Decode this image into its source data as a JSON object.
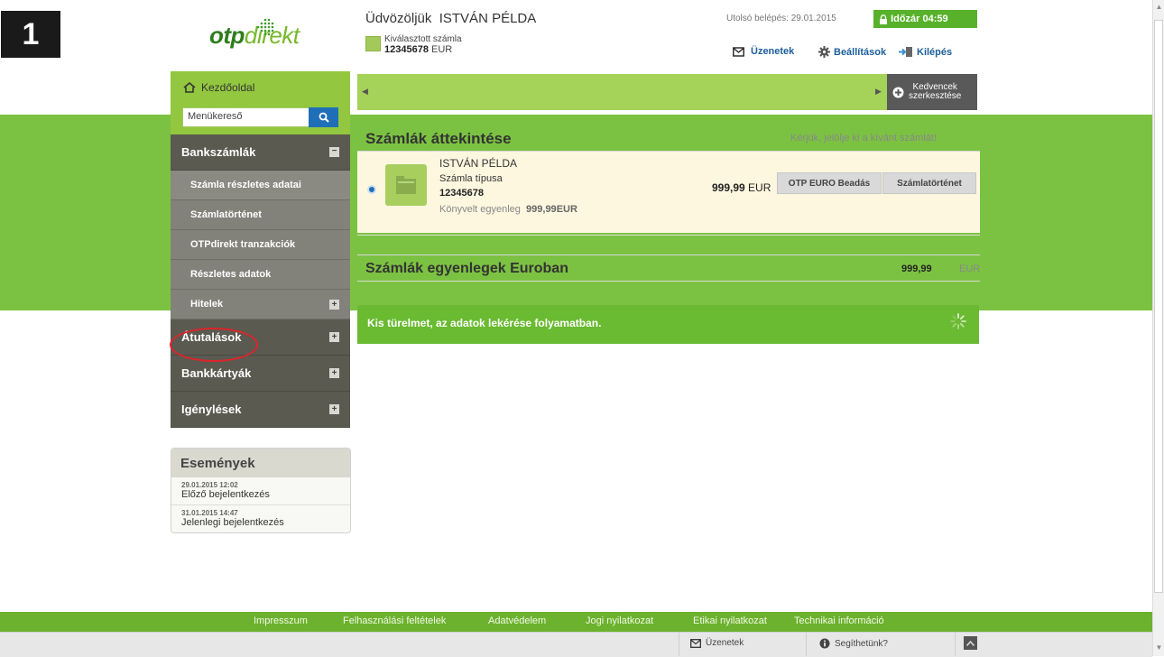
{
  "step_badge": "1",
  "logo": {
    "part1": "otp",
    "part2": "direkt"
  },
  "header": {
    "welcome_prefix": "Üdvözöljük",
    "user_name": "ISTVÁN PÉLDA",
    "selected_account_label": "Kiválasztott számla",
    "selected_account_number": "12345678",
    "selected_account_currency": "EUR",
    "last_login_label": "Utolsó belépés:",
    "last_login_date": "29.01.2015",
    "timer_label": "Időzár",
    "timer_value": "04:59",
    "messages_label": "Üzenetek",
    "settings_label": "Beállítások",
    "logout_label": "Kilépés"
  },
  "nav": {
    "home_label": "Kezdőoldal",
    "search_placeholder": "Menükereső",
    "sections": [
      {
        "label": "Bankszámlák",
        "expanded": true
      },
      {
        "label": "Átutalások",
        "expanded": false
      },
      {
        "label": "Bankkártyák",
        "expanded": false
      },
      {
        "label": "Igénylések",
        "expanded": false
      }
    ],
    "sub_items": [
      {
        "label": "Számla részletes adatai"
      },
      {
        "label": "Számlatörténet"
      },
      {
        "label": "OTPdirekt tranzakciók"
      },
      {
        "label": "Részletes adatok"
      },
      {
        "label": "Hitelek"
      }
    ]
  },
  "events": {
    "title": "Események",
    "items": [
      {
        "date": "29.01.2015 12:02",
        "text": "Előző bejelentkezés"
      },
      {
        "date": "31.01.2015 14:47",
        "text": "Jelenlegi bejelentkezés"
      }
    ]
  },
  "favorites": {
    "edit_label_line1": "Kedvencek",
    "edit_label_line2": "szerkesztése",
    "left_arrow": "◀",
    "right_arrow": "▶"
  },
  "overview": {
    "title": "Számlák áttekintése",
    "hint": "Kérjük, jelölje ki a kívánt számlát!",
    "account": {
      "holder": "ISTVÁN PÉLDA",
      "type": "Számla típusa",
      "number": "12345678",
      "booked_label": "Könyvelt egyenleg",
      "booked_value": "999,99",
      "booked_currency": "EUR",
      "balance_value": "999,99",
      "balance_currency": "EUR",
      "btn_deposit": "OTP EURO Beadás",
      "btn_history": "Számlatörténet"
    }
  },
  "euro_summary": {
    "title": "Számlák egyenlegek Euroban",
    "value": "999,99",
    "currency": "EUR"
  },
  "loading": {
    "text": "Kis türelmet, az adatok lekérése folyamatban."
  },
  "footer": {
    "links": [
      "Impresszum",
      "Felhasználási feltételek",
      "Adatvédelem",
      "Jogi nyilatkozat",
      "Etikai nyilatkozat",
      "Technikai információ"
    ]
  },
  "bottom_bar": {
    "messages_label": "Üzenetek",
    "help_label": "Segíthetünk?"
  },
  "colors": {
    "brand_green": "#7cc242",
    "nav_dark": "#5a5a50",
    "highlight_red": "#e0232a",
    "link_blue": "#1b5e9b"
  }
}
